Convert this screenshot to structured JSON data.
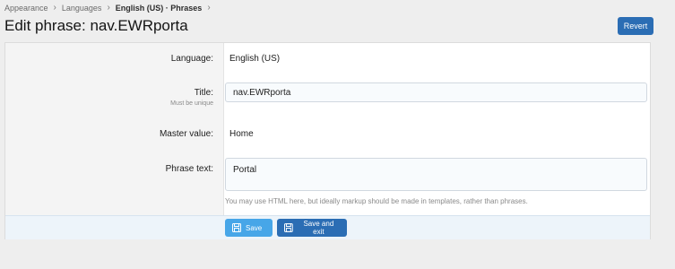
{
  "breadcrumb": {
    "items": [
      "Appearance",
      "Languages",
      "English (US) · Phrases"
    ],
    "separator": "›"
  },
  "page": {
    "title": "Edit phrase: nav.EWRporta"
  },
  "header": {
    "revert_label": "Revert"
  },
  "form": {
    "language": {
      "label": "Language:",
      "value": "English (US)"
    },
    "title": {
      "label": "Title:",
      "hint": "Must be unique",
      "value": "nav.EWRporta"
    },
    "master": {
      "label": "Master value:",
      "value": "Home"
    },
    "phrase": {
      "label": "Phrase text:",
      "value": "Portal",
      "explain": "You may use HTML here, but ideally markup should be made in templates, rather than phrases."
    }
  },
  "footer": {
    "save_label": "Save",
    "save_exit_label": "Save and exit",
    "icon": "floppy-disk-icon"
  },
  "colors": {
    "primary": "#2b6db4",
    "primary_light": "#47a6e8",
    "footer_bg": "#edf4fa"
  }
}
